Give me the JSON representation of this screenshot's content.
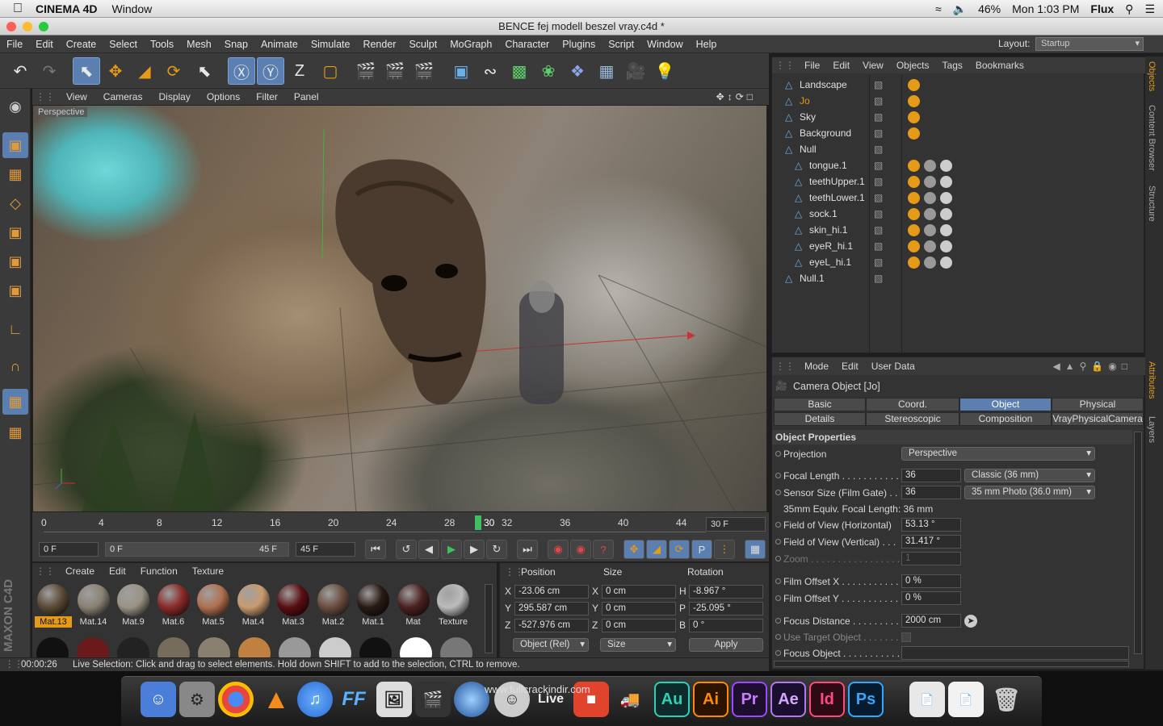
{
  "macbar": {
    "app": "CINEMA 4D",
    "menu": "Window",
    "battery": "46%",
    "clock": "Mon 1:03 PM",
    "user": "Flux"
  },
  "window": {
    "title": "BENCE fej modell beszel vray.c4d *"
  },
  "menu": [
    "File",
    "Edit",
    "Create",
    "Select",
    "Tools",
    "Mesh",
    "Snap",
    "Animate",
    "Simulate",
    "Render",
    "Sculpt",
    "MoGraph",
    "Character",
    "Plugins",
    "Script",
    "Window",
    "Help"
  ],
  "layout": {
    "label": "Layout:",
    "value": "Startup"
  },
  "viewport": {
    "menu": [
      "View",
      "Cameras",
      "Display",
      "Options",
      "Filter",
      "Panel"
    ],
    "label": "Perspective"
  },
  "timeline": {
    "ticks": [
      "0",
      "4",
      "8",
      "12",
      "16",
      "20",
      "24",
      "28",
      "30",
      "32",
      "36",
      "40",
      "44"
    ],
    "end_frame": "30 F"
  },
  "transport": {
    "start": "0 F",
    "range_start": "0 F",
    "range_end": "45 F",
    "end": "45 F"
  },
  "materials": {
    "menu": [
      "Create",
      "Edit",
      "Function",
      "Texture"
    ],
    "row1": [
      {
        "name": "Mat.13",
        "color": "#5a4a36"
      },
      {
        "name": "Mat.14",
        "color": "#8a8172"
      },
      {
        "name": "Mat.9",
        "color": "#9a9385"
      },
      {
        "name": "Mat.6",
        "color": "#8a2a2a"
      },
      {
        "name": "Mat.5",
        "color": "#b07050"
      },
      {
        "name": "Mat.4",
        "color": "#c89a70"
      },
      {
        "name": "Mat.3",
        "color": "#5a0f12"
      },
      {
        "name": "Mat.2",
        "color": "#6a4e40"
      },
      {
        "name": "Mat.1",
        "color": "#2a1a14"
      },
      {
        "name": "Mat",
        "color": "#4a2220"
      },
      {
        "name": "Texture",
        "color": "#bbbbbb"
      }
    ]
  },
  "coords": {
    "headers": [
      "Position",
      "Size",
      "Rotation"
    ],
    "rows": [
      {
        "axis": "X",
        "pos": "-23.06 cm",
        "saxis": "X",
        "size": "0 cm",
        "raxis": "H",
        "rot": "-8.967 °"
      },
      {
        "axis": "Y",
        "pos": "295.587 cm",
        "saxis": "Y",
        "size": "0 cm",
        "raxis": "P",
        "rot": "-25.095 °"
      },
      {
        "axis": "Z",
        "pos": "-527.976 cm",
        "saxis": "Z",
        "size": "0 cm",
        "raxis": "B",
        "rot": "0 °"
      }
    ],
    "mode": "Object (Rel)",
    "size_mode": "Size",
    "apply": "Apply"
  },
  "status": {
    "time": "00:00:26",
    "text": "Live Selection: Click and drag to select elements. Hold down SHIFT to add to the selection, CTRL to remove."
  },
  "objects": {
    "menu": [
      "File",
      "Edit",
      "View",
      "Objects",
      "Tags",
      "Bookmarks"
    ],
    "items": [
      {
        "name": "Landscape",
        "indent": 0,
        "color": "#e0e0e0"
      },
      {
        "name": "Jo",
        "indent": 0,
        "color": "#e59a18"
      },
      {
        "name": "Sky",
        "indent": 0,
        "color": "#e0e0e0"
      },
      {
        "name": "Background",
        "indent": 0,
        "color": "#e0e0e0"
      },
      {
        "name": "Null",
        "indent": 0,
        "color": "#e0e0e0"
      },
      {
        "name": "tongue.1",
        "indent": 1,
        "color": "#e0e0e0"
      },
      {
        "name": "teethUpper.1",
        "indent": 1,
        "color": "#e0e0e0"
      },
      {
        "name": "teethLower.1",
        "indent": 1,
        "color": "#e0e0e0"
      },
      {
        "name": "sock.1",
        "indent": 1,
        "color": "#e0e0e0"
      },
      {
        "name": "skin_hi.1",
        "indent": 1,
        "color": "#e0e0e0"
      },
      {
        "name": "eyeR_hi.1",
        "indent": 1,
        "color": "#e0e0e0"
      },
      {
        "name": "eyeL_hi.1",
        "indent": 1,
        "color": "#e0e0e0"
      },
      {
        "name": "Null.1",
        "indent": 0,
        "color": "#e0e0e0"
      }
    ]
  },
  "attributes": {
    "menu": [
      "Mode",
      "Edit",
      "User Data"
    ],
    "title": "Camera Object [Jo]",
    "tabs1": [
      "Basic",
      "Coord.",
      "Object",
      "Physical"
    ],
    "tabs2": [
      "Details",
      "Stereoscopic",
      "Composition",
      "VrayPhysicalCamera"
    ],
    "section": "Object Properties",
    "projection": {
      "label": "Projection",
      "value": "Perspective"
    },
    "focal": {
      "label": "Focal Length . . . . . . . . . . .",
      "value": "36",
      "preset": "Classic (36 mm)"
    },
    "sensor": {
      "label": "Sensor Size (Film Gate) . . .",
      "value": "36",
      "preset": "35 mm Photo (36.0 mm)"
    },
    "equiv": "35mm Equiv. Focal Length: 36 mm",
    "fovh": {
      "label": "Field of View (Horizontal)",
      "value": "53.13 °"
    },
    "fovv": {
      "label": "Field of View (Vertical) . . .",
      "value": "31.417 °"
    },
    "zoom": {
      "label": "Zoom . . . . . . . . . . . . . . . . .",
      "value": "1"
    },
    "offx": {
      "label": "Film Offset X . . . . . . . . . . .",
      "value": "0 %"
    },
    "offy": {
      "label": "Film Offset Y . . . . . . . . . . .",
      "value": "0 %"
    },
    "focusd": {
      "label": "Focus Distance . . . . . . . . .",
      "value": "2000 cm"
    },
    "usetarget": {
      "label": "Use Target Object . . . . . . ."
    },
    "focuso": {
      "label": "Focus Object . . . . . . . . . . ."
    }
  },
  "side_tabs": [
    "Objects",
    "Content Browser",
    "Structure",
    "Attributes",
    "Layers"
  ],
  "dock": {
    "watermark": "www.fullcrackindir.com",
    "apps": [
      "Au",
      "Ai",
      "Pr",
      "Ae",
      "Id",
      "Ps"
    ],
    "live": "Live"
  }
}
